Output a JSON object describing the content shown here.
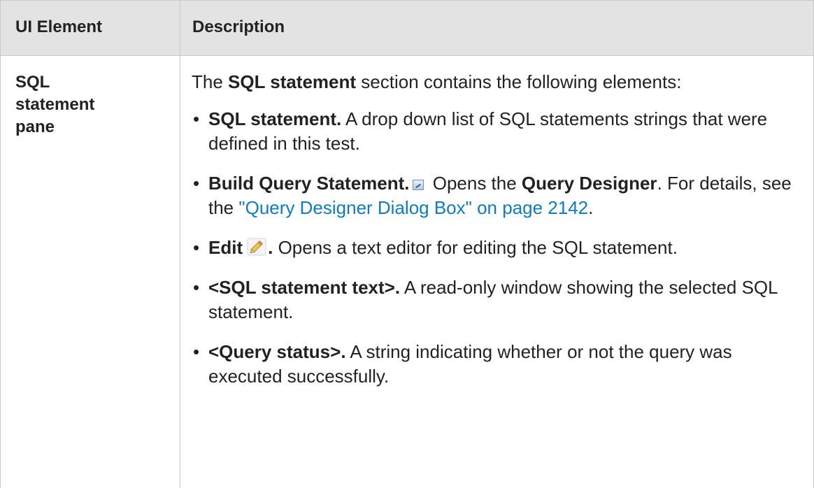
{
  "table": {
    "headers": {
      "col1": "UI Element",
      "col2": "Description"
    },
    "row": {
      "element": {
        "line1": "SQL",
        "line2": "statement",
        "line3": "pane"
      },
      "intro": {
        "pre": "The ",
        "bold": "SQL statement",
        "post": " section contains the following elements:"
      },
      "items": [
        {
          "title": "SQL statement.",
          "text": " A drop down list of SQL statements strings that were defined in this test."
        },
        {
          "title": "Build Query Statement.",
          "icon": "query-designer-icon",
          "text_pre": " Opens the ",
          "bold": "Query Designer",
          "text_mid": ". For details, see the ",
          "link": "\"Query Designer Dialog Box\" on page 2142",
          "text_post": "."
        },
        {
          "title": "Edit",
          "icon": "pencil-icon",
          "title_suffix": ".",
          "text": " Opens a text editor for editing the SQL statement."
        },
        {
          "title": "<SQL statement text>.",
          "text": " A read-only window showing the selected SQL statement."
        },
        {
          "title": "<Query status>.",
          "text": " A string indicating whether or not the query was executed successfully."
        }
      ]
    }
  },
  "colors": {
    "header_bg": "#e3e3e3",
    "border": "#c8c8c8",
    "link": "#0e7dbd",
    "text": "#222222"
  }
}
